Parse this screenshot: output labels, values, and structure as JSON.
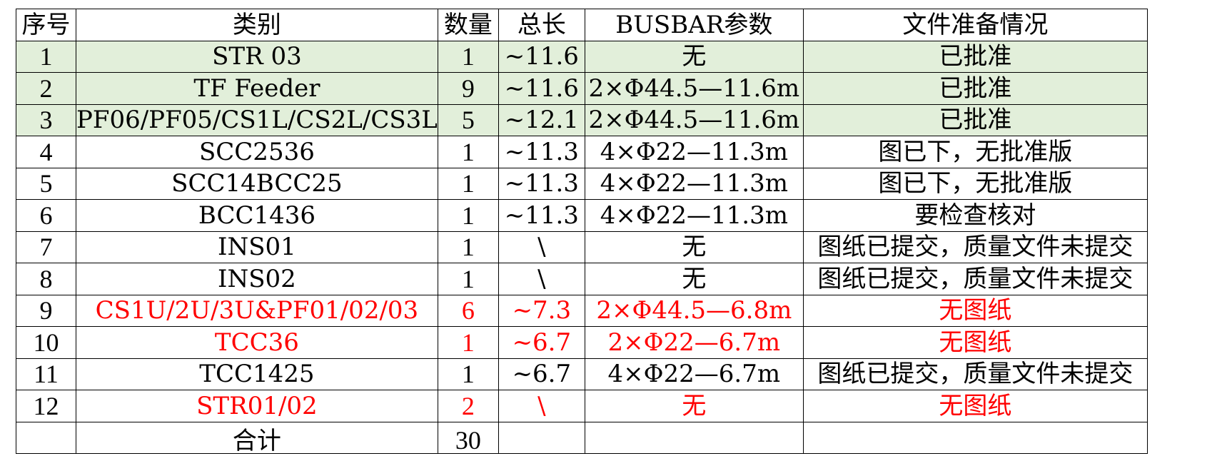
{
  "headers": [
    "序号",
    "类别",
    "数量",
    "总长",
    "BUSBAR参数",
    "文件准备情况"
  ],
  "rows": [
    {
      "idx": "1",
      "category": "STR 03",
      "qty": "1",
      "length": "~11.6",
      "busbar": "无",
      "status": "已批准",
      "style": "green"
    },
    {
      "idx": "2",
      "category": "TF Feeder",
      "qty": "9",
      "length": "~11.6",
      "busbar": "2×Φ44.5—11.6m",
      "status": "已批准",
      "style": "green"
    },
    {
      "idx": "3",
      "category": "PF06/PF05/CS1L/CS2L/CS3L",
      "qty": "5",
      "length": "~12.1",
      "busbar": "2×Φ44.5—11.6m",
      "status": "已批准",
      "style": "green"
    },
    {
      "idx": "4",
      "category": "SCC2536",
      "qty": "1",
      "length": "~11.3",
      "busbar": "4×Φ22—11.3m",
      "status": "图已下，无批准版",
      "style": "normal"
    },
    {
      "idx": "5",
      "category": "SCC14BCC25",
      "qty": "1",
      "length": "~11.3",
      "busbar": "4×Φ22—11.3m",
      "status": "图已下，无批准版",
      "style": "normal"
    },
    {
      "idx": "6",
      "category": "BCC1436",
      "qty": "1",
      "length": "~11.3",
      "busbar": "4×Φ22—11.3m",
      "status": "要检查核对",
      "style": "normal"
    },
    {
      "idx": "7",
      "category": "INS01",
      "qty": "1",
      "length": "\\",
      "busbar": "无",
      "status": "图纸已提交，质量文件未提交",
      "style": "normal"
    },
    {
      "idx": "8",
      "category": "INS02",
      "qty": "1",
      "length": "\\",
      "busbar": "无",
      "status": "图纸已提交，质量文件未提交",
      "style": "normal"
    },
    {
      "idx": "9",
      "category": "CS1U/2U/3U&PF01/02/03",
      "qty": "6",
      "length": "~7.3",
      "busbar": "2×Φ44.5—6.8m",
      "status": "无图纸",
      "style": "red"
    },
    {
      "idx": "10",
      "category": "TCC36",
      "qty": "1",
      "length": "~6.7",
      "busbar": "2×Φ22—6.7m",
      "status": "无图纸",
      "style": "red"
    },
    {
      "idx": "11",
      "category": "TCC1425",
      "qty": "1",
      "length": "~6.7",
      "busbar": "4×Φ22—6.7m",
      "status": "图纸已提交，质量文件未提交",
      "style": "normal"
    },
    {
      "idx": "12",
      "category": "STR01/02",
      "qty": "2",
      "length": "\\",
      "busbar": "无",
      "status": "无图纸",
      "style": "red"
    }
  ],
  "total": {
    "label": "合计",
    "qty": "30"
  },
  "colors": {
    "green_fill": "#e2efda",
    "red_text": "#ff0000"
  }
}
